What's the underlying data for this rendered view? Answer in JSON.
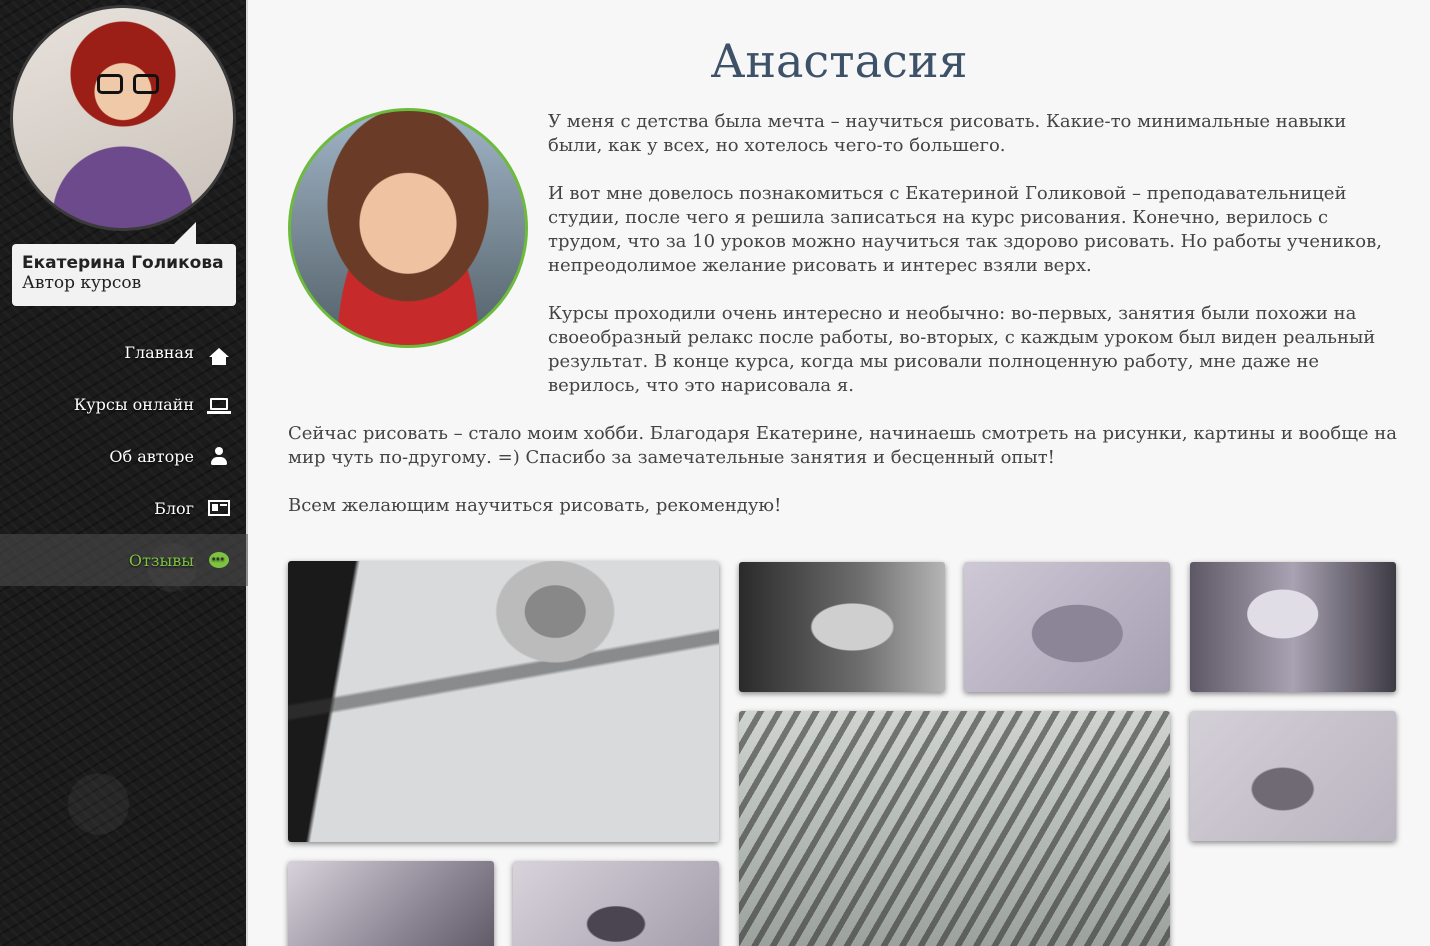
{
  "author": {
    "name": "Екатерина Голикова",
    "role": "Автор курсов"
  },
  "nav": {
    "items": [
      {
        "label": "Главная",
        "icon": "home-icon",
        "active": false
      },
      {
        "label": "Курсы онлайн",
        "icon": "laptop-icon",
        "active": false
      },
      {
        "label": "Об авторе",
        "icon": "user-icon",
        "active": false
      },
      {
        "label": "Блог",
        "icon": "newspaper-icon",
        "active": false
      },
      {
        "label": "Отзывы",
        "icon": "chat-icon",
        "active": true
      }
    ]
  },
  "review": {
    "name": "Анастасия",
    "paragraphs": [
      "У меня с детства была мечта – научиться рисовать. Какие-то минимальные навыки были, как у всех, но хотелось чего-то большего.",
      "И вот мне довелось познакомиться с Екатериной Голиковой – преподавательницей студии, после чего я решила записаться на курс рисования. Конечно, верилось с трудом, что за 10 уроков можно научиться так здорово рисовать. Но работы учеников, непреодолимое желание рисовать и интерес взяли верх.",
      "Курсы проходили очень интересно и необычно: во-первых, занятия были похожи на своеобразный релакс после работы, во-вторых, с каждым уроком был виден реальный результат. В конце курса, когда мы рисовали полноценную работу, мне даже не верилось, что это нарисовала я.",
      "Сейчас рисовать – стало моим хобби. Благодаря Екатерине, начинаешь смотреть на рисунки, картины и вообще на мир чуть по-другому. =) Спасибо за замечательные занятия и бесценный опыт!",
      "Всем желающим научиться рисовать, рекомендую!"
    ]
  },
  "colors": {
    "accent": "#7dc242",
    "title": "#3d5168",
    "sidebar_bg": "#1b1b1b"
  }
}
